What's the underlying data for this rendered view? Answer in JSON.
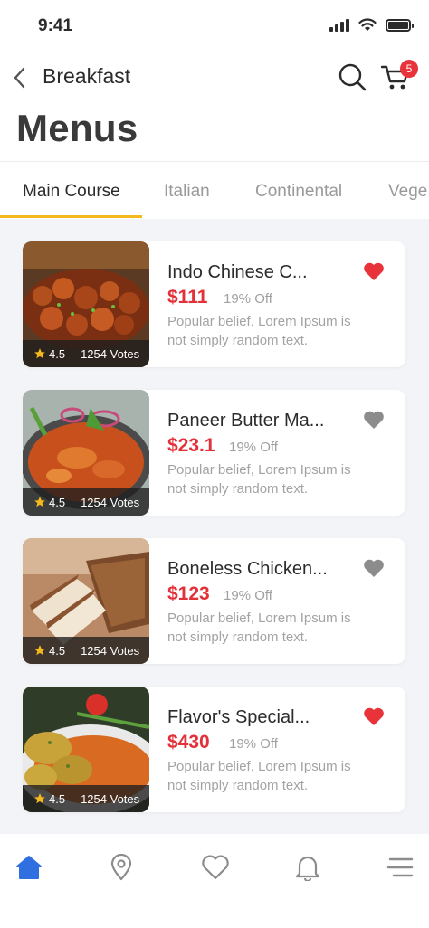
{
  "status_bar": {
    "time": "9:41"
  },
  "header": {
    "title": "Breakfast",
    "cart_count": "5"
  },
  "page": {
    "title": "Menus"
  },
  "tabs": [
    {
      "label": "Main Course",
      "active": true
    },
    {
      "label": "Italian",
      "active": false
    },
    {
      "label": "Continental",
      "active": false
    },
    {
      "label": "Vege",
      "active": false
    }
  ],
  "items": [
    {
      "title": "Indo Chinese C...",
      "price": "$111",
      "discount": "19% Off",
      "description": "Popular belief, Lorem Ipsum is not simply random text.",
      "rating": "4.5",
      "votes": "1254 Votes",
      "favorite": true
    },
    {
      "title": "Paneer Butter Ma...",
      "price": "$23.1",
      "discount": "19% Off",
      "description": "Popular belief, Lorem Ipsum is not simply random text.",
      "rating": "4.5",
      "votes": "1254 Votes",
      "favorite": false
    },
    {
      "title": "Boneless Chicken...",
      "price": "$123",
      "discount": "19% Off",
      "description": "Popular belief, Lorem Ipsum is not simply random text.",
      "rating": "4.5",
      "votes": "1254 Votes",
      "favorite": false
    },
    {
      "title": "Flavor's Special...",
      "price": "$430",
      "discount": "19% Off",
      "description": "Popular belief, Lorem Ipsum is not simply random text.",
      "rating": "4.5",
      "votes": "1254 Votes",
      "favorite": true
    }
  ],
  "nav": [
    {
      "icon": "home-icon",
      "active": true
    },
    {
      "icon": "location-pin-icon",
      "active": false
    },
    {
      "icon": "heart-icon",
      "active": false
    },
    {
      "icon": "bell-icon",
      "active": false
    },
    {
      "icon": "menu-icon",
      "active": false
    }
  ],
  "colors": {
    "accent": "#f5b91e",
    "price": "#e33139",
    "favorite": "#e8333a",
    "nav_active": "#2f6fe0"
  }
}
